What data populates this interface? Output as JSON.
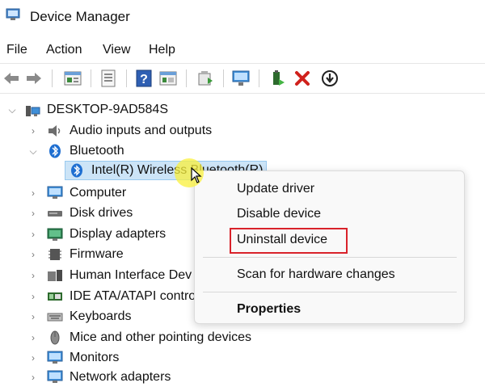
{
  "window": {
    "title": "Device Manager",
    "icon": "device-manager-icon"
  },
  "menu": [
    "File",
    "Action",
    "View",
    "Help"
  ],
  "toolbar": [
    "back-arrow-icon",
    "forward-arrow-icon",
    "properties-sheet-icon",
    "device-list-icon",
    "help-icon",
    "view-pane-icon",
    "update-driver-icon",
    "scan-hardware-icon",
    "enable-device-icon",
    "uninstall-x-icon",
    "download-icon"
  ],
  "tree": {
    "root": "DESKTOP-9AD584S",
    "items": [
      {
        "label": "Audio inputs and outputs",
        "icon": "speaker-icon",
        "expanded": false
      },
      {
        "label": "Bluetooth",
        "icon": "bluetooth-icon",
        "expanded": true
      },
      {
        "label": "Intel(R) Wireless Bluetooth(R)",
        "icon": "bluetooth-icon",
        "child": true,
        "selected": true
      },
      {
        "label": "Computer",
        "icon": "computer-icon",
        "expanded": false
      },
      {
        "label": "Disk drives",
        "icon": "disk-drive-icon",
        "expanded": false
      },
      {
        "label": "Display adapters",
        "icon": "display-adapter-icon",
        "expanded": false
      },
      {
        "label": "Firmware",
        "icon": "firmware-icon",
        "expanded": false
      },
      {
        "label": "Human Interface Dev",
        "icon": "hid-icon",
        "expanded": false
      },
      {
        "label": "IDE ATA/ATAPI control",
        "icon": "ide-controller-icon",
        "expanded": false
      },
      {
        "label": "Keyboards",
        "icon": "keyboard-icon",
        "expanded": false
      },
      {
        "label": "Mice and other pointing devices",
        "icon": "mouse-icon",
        "expanded": false
      },
      {
        "label": "Monitors",
        "icon": "monitor-icon",
        "expanded": false
      },
      {
        "label": "Network adapters",
        "icon": "network-adapter-icon",
        "expanded": false
      }
    ]
  },
  "context_menu": {
    "items": [
      "Update driver",
      "Disable device",
      "Uninstall device",
      "Scan for hardware changes",
      "Properties"
    ],
    "highlighted": "Uninstall device"
  },
  "colors": {
    "highlight_border": "#d9222a",
    "selection_bg": "#cce4f7",
    "cursor_glow": "#faf03c"
  }
}
